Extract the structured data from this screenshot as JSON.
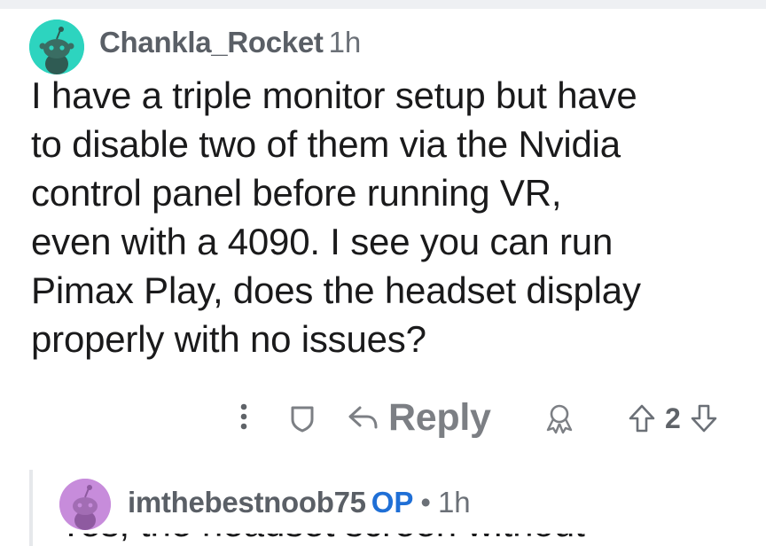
{
  "comment": {
    "author": "Chankla_Rocket",
    "time": "1h",
    "body_lines": [
      "I have a triple monitor setup but have",
      "to disable two of them via the Nvidia",
      "control panel before running VR,",
      "even with a 4090. I see you can run",
      "Pimax Play, does the headset display",
      "properly with no issues?"
    ],
    "actions": {
      "reply_label": "Reply",
      "vote_count": "2"
    }
  },
  "reply": {
    "author": "imthebestnoob75",
    "op_badge": "OP",
    "separator": "•",
    "time": "1h",
    "body_partial": "Yes, the headset screen without"
  },
  "colors": {
    "avatar1": "#2dd4bf",
    "avatar2": "#c78cdb",
    "op_badge": "#1f6fd6",
    "icon_gray": "#7c7f84"
  }
}
